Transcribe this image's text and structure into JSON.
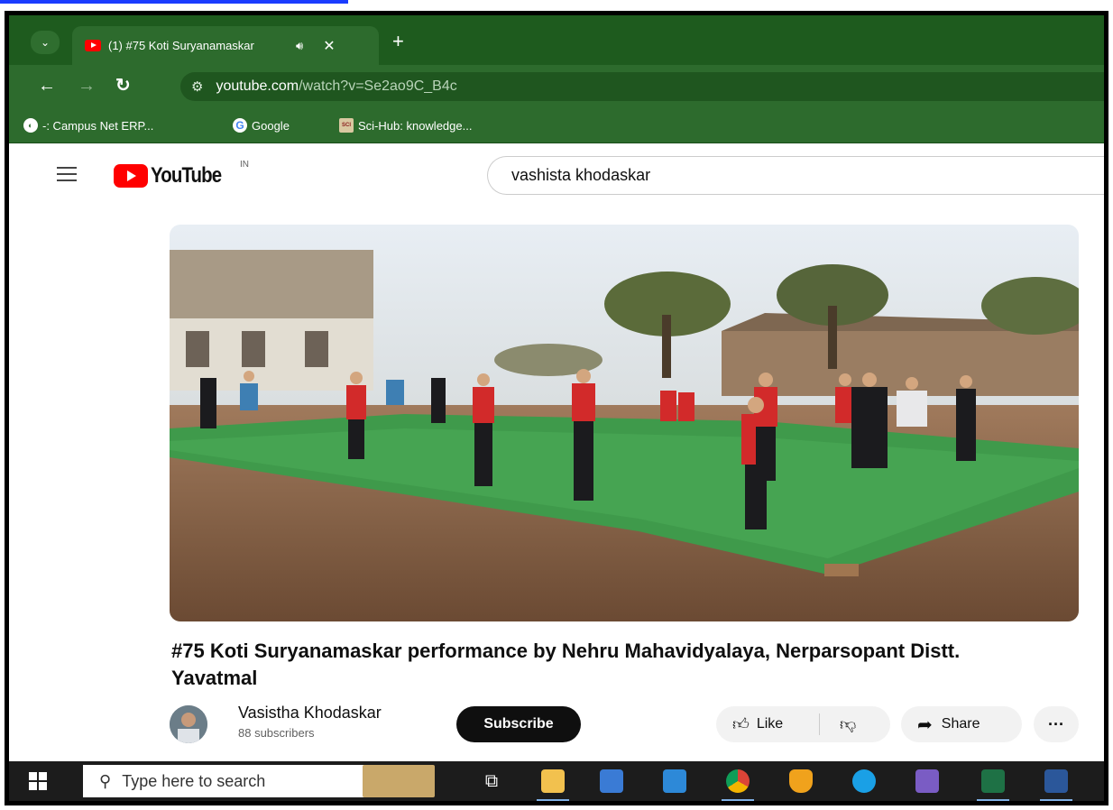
{
  "browser": {
    "tab_title": "(1) #75 Koti Suryanamaskar",
    "tab_audio_icon": "speaker-icon",
    "tab_close": "✕",
    "new_tab": "+",
    "url_host": "youtube.com",
    "url_path": "/watch?v=Se2ao9C_B4c",
    "bookmarks": [
      {
        "label": "-: Campus Net ERP..."
      },
      {
        "label": "Google"
      },
      {
        "label": "Sci-Hub: knowledge..."
      }
    ]
  },
  "youtube": {
    "logo_text": "YouTube",
    "country_code": "IN",
    "search_value": "vashista khodaskar",
    "video_title": "#75 Koti Suryanamaskar performance by Nehru Mahavidyalaya, Nerparsopant Distt. Yavatmal",
    "channel_name": "Vasistha Khodaskar",
    "subscribers": "88 subscribers",
    "subscribe_label": "Subscribe",
    "like_label": "Like",
    "share_label": "Share",
    "more_label": "···"
  },
  "taskbar": {
    "search_placeholder": "Type here to search"
  }
}
